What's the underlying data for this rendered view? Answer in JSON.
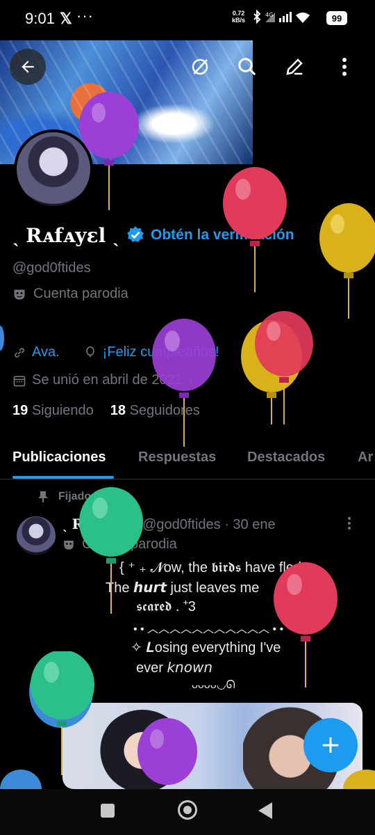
{
  "status": {
    "time": "9:01",
    "x_logo": "𝕏",
    "dots": "···",
    "net_rate": "0.72",
    "net_unit": "kB/s",
    "battery": "99"
  },
  "header": {
    "back_icon": "back-arrow-icon",
    "action_icons": [
      "grok-icon",
      "search-icon",
      "edit-icon",
      "more-icon"
    ]
  },
  "profile": {
    "name": "ˎ Rᴀfᴀyεl ˎ",
    "verify_link": "Obtén la verificación",
    "handle": "@god0ftides",
    "parody": "Cuenta parodia",
    "link": "Ava.",
    "birthday": "¡Feliz cumpleaños!",
    "joined": "Se unió en abril de 2021",
    "following_count": "19",
    "following_label": "Siguiendo",
    "followers_count": "18",
    "followers_label": "Seguidores"
  },
  "tabs": [
    "Publicaciones",
    "Respuestas",
    "Destacados",
    "Ar"
  ],
  "post": {
    "pinned_label": "Fijado",
    "author": "ˎ Rᴀfᴀyεl ˎ",
    "handle_time": "@god0ftides · 30 ene",
    "parody": "Cuenta parodia",
    "lines": [
      "{ ⁺ ₊ 𝓝ow, the 𝖇𝖎𝖗𝖉𝖘 have fled",
      "The 𝙝𝙪𝙧𝙩 just leaves me",
      "𝖘𝖈𝖆𝖗𝖊𝖉 . ⁺3",
      "• • ︿︿︿︿︿︿︿︿︿︿︿ • •",
      "✧ 𝑳osing everything I've",
      "ever 𝘬𝘯𝘰𝘸𝘯",
      "ᴗᴗᴗᴗ◡ᘏ"
    ]
  },
  "fab_label": "+",
  "colors": {
    "accent": "#1d9bf0",
    "muted": "#71767b",
    "bg": "#000000"
  }
}
